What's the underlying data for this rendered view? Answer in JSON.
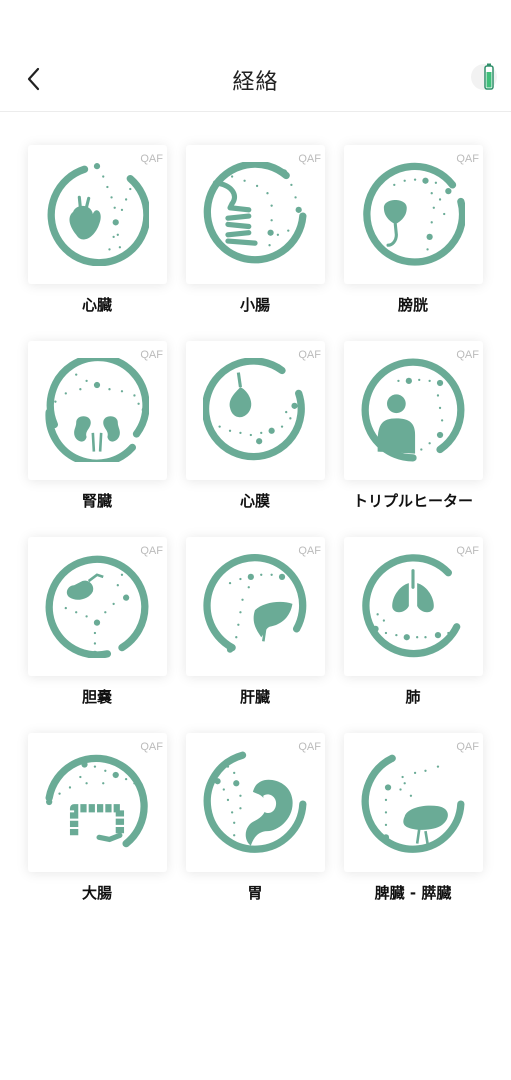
{
  "header": {
    "title": "経絡",
    "back_icon": "chevron-left-icon",
    "battery_icon": "battery-icon"
  },
  "colors": {
    "accent": "#6aab96",
    "label": "#111111",
    "badge": "#bbbbbb"
  },
  "meridians": [
    {
      "label": "心臓",
      "badge": "QAF",
      "icon": "heart-icon"
    },
    {
      "label": "小腸",
      "badge": "QAF",
      "icon": "small-intestine-icon"
    },
    {
      "label": "膀胱",
      "badge": "QAF",
      "icon": "bladder-icon"
    },
    {
      "label": "腎臓",
      "badge": "QAF",
      "icon": "kidneys-icon"
    },
    {
      "label": "心膜",
      "badge": "QAF",
      "icon": "pericardium-icon"
    },
    {
      "label": "トリプルヒーター",
      "badge": "QAF",
      "icon": "person-icon"
    },
    {
      "label": "胆嚢",
      "badge": "QAF",
      "icon": "gallbladder-icon"
    },
    {
      "label": "肝臓",
      "badge": "QAF",
      "icon": "liver-icon"
    },
    {
      "label": "肺",
      "badge": "QAF",
      "icon": "lungs-icon"
    },
    {
      "label": "大腸",
      "badge": "QAF",
      "icon": "large-intestine-icon"
    },
    {
      "label": "胃",
      "badge": "QAF",
      "icon": "stomach-icon"
    },
    {
      "label": "脾臓 - 膵臓",
      "badge": "QAF",
      "icon": "spleen-icon"
    }
  ]
}
